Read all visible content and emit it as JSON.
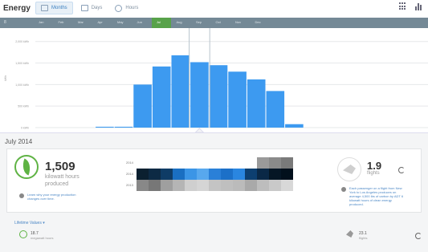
{
  "app": {
    "title": "Energy",
    "tabs": [
      {
        "label": "Months",
        "icon": "calendar-icon",
        "active": true
      },
      {
        "label": "Days",
        "icon": "calendar-icon",
        "active": false
      },
      {
        "label": "Hours",
        "icon": "clock-icon",
        "active": false
      }
    ],
    "right_icons": [
      "grid-icon",
      "bar-chart-icon"
    ]
  },
  "month_axis": {
    "year_label": "8",
    "months": [
      "Jan",
      "Feb",
      "Mar",
      "Apr",
      "May",
      "Jun",
      "Jul",
      "Aug",
      "Sep",
      "Oct",
      "Nov",
      "Dec"
    ],
    "selected": "Jul"
  },
  "chart_data": {
    "type": "bar",
    "ylabel": "kWh",
    "y_ticks": [
      "2,000 kWh",
      "1,500 kWh",
      "1,000 kWh",
      "500 kWh",
      "0 kWh"
    ],
    "ylim": [
      0,
      2200
    ],
    "categories": [
      "",
      "",
      "",
      "",
      "",
      "",
      "",
      "",
      "",
      "",
      "",
      "",
      "",
      "",
      "",
      "",
      "",
      "",
      "",
      "",
      "",
      "",
      "",
      "",
      "",
      "",
      ""
    ],
    "values": [
      0,
      0,
      0,
      0,
      0,
      0,
      0,
      0,
      0,
      0,
      0,
      20,
      20,
      1000,
      1420,
      1680,
      1520,
      1450,
      1300,
      1120,
      850,
      80,
      0,
      0,
      0,
      0,
      0
    ],
    "selected_index": 16,
    "color": "#3d9af0",
    "selected_color": "#3d9af0",
    "grid": true
  },
  "panel": {
    "title": "July 2014",
    "energy": {
      "icon": "leaf-icon",
      "value": "1,509",
      "unit_line1": "kilowatt hours",
      "unit_line2": "produced",
      "info_text_line1": "Learn why your energy production",
      "info_text_line2": "changes over time."
    },
    "heatmap": {
      "rows": [
        {
          "year": "2014",
          "colors": [
            "transparent",
            "transparent",
            "transparent",
            "transparent",
            "transparent",
            "transparent",
            "transparent",
            "transparent",
            "transparent",
            "transparent",
            "#9a9a9a",
            "#8a8a8a",
            "#7a7a7a"
          ]
        },
        {
          "year": "2014",
          "colors": [
            "#0b2030",
            "#0d2a44",
            "#0f3c66",
            "#1a6fc2",
            "#3b95e6",
            "#58a8ee",
            "#2a80d8",
            "#1c70c8",
            "#2a86e0",
            "#0d3f70",
            "#0a2846",
            "#051625",
            "#02101c"
          ]
        },
        {
          "year": "2013",
          "colors": [
            "#888888",
            "#777777",
            "#9f9f9f",
            "#b5b5b5",
            "#cfcfcf",
            "#d5d5d5",
            "#c4c4c4",
            "#bfbfbf",
            "#bbbbbb",
            "#a9a9a9",
            "#bdbdbd",
            "#c9c9c9",
            "#d8d8d8"
          ]
        }
      ]
    },
    "flights": {
      "icon": "airplane-icon",
      "value": "1.9",
      "label": "flights",
      "info_line1": "Each passenger on a flight from New",
      "info_line2": "York to Los Angeles produces on",
      "info_line3": "average 4,500 lbs of carbon by ADT 6",
      "info_line4": "kilowatt hours of clean energy",
      "info_line5": "produced."
    },
    "lifetime": {
      "label": "Lifetime Values ▾",
      "energy_value": "18.7",
      "energy_unit": "megawatt hours",
      "flights_value": "23.1",
      "flights_unit": "flights"
    }
  }
}
